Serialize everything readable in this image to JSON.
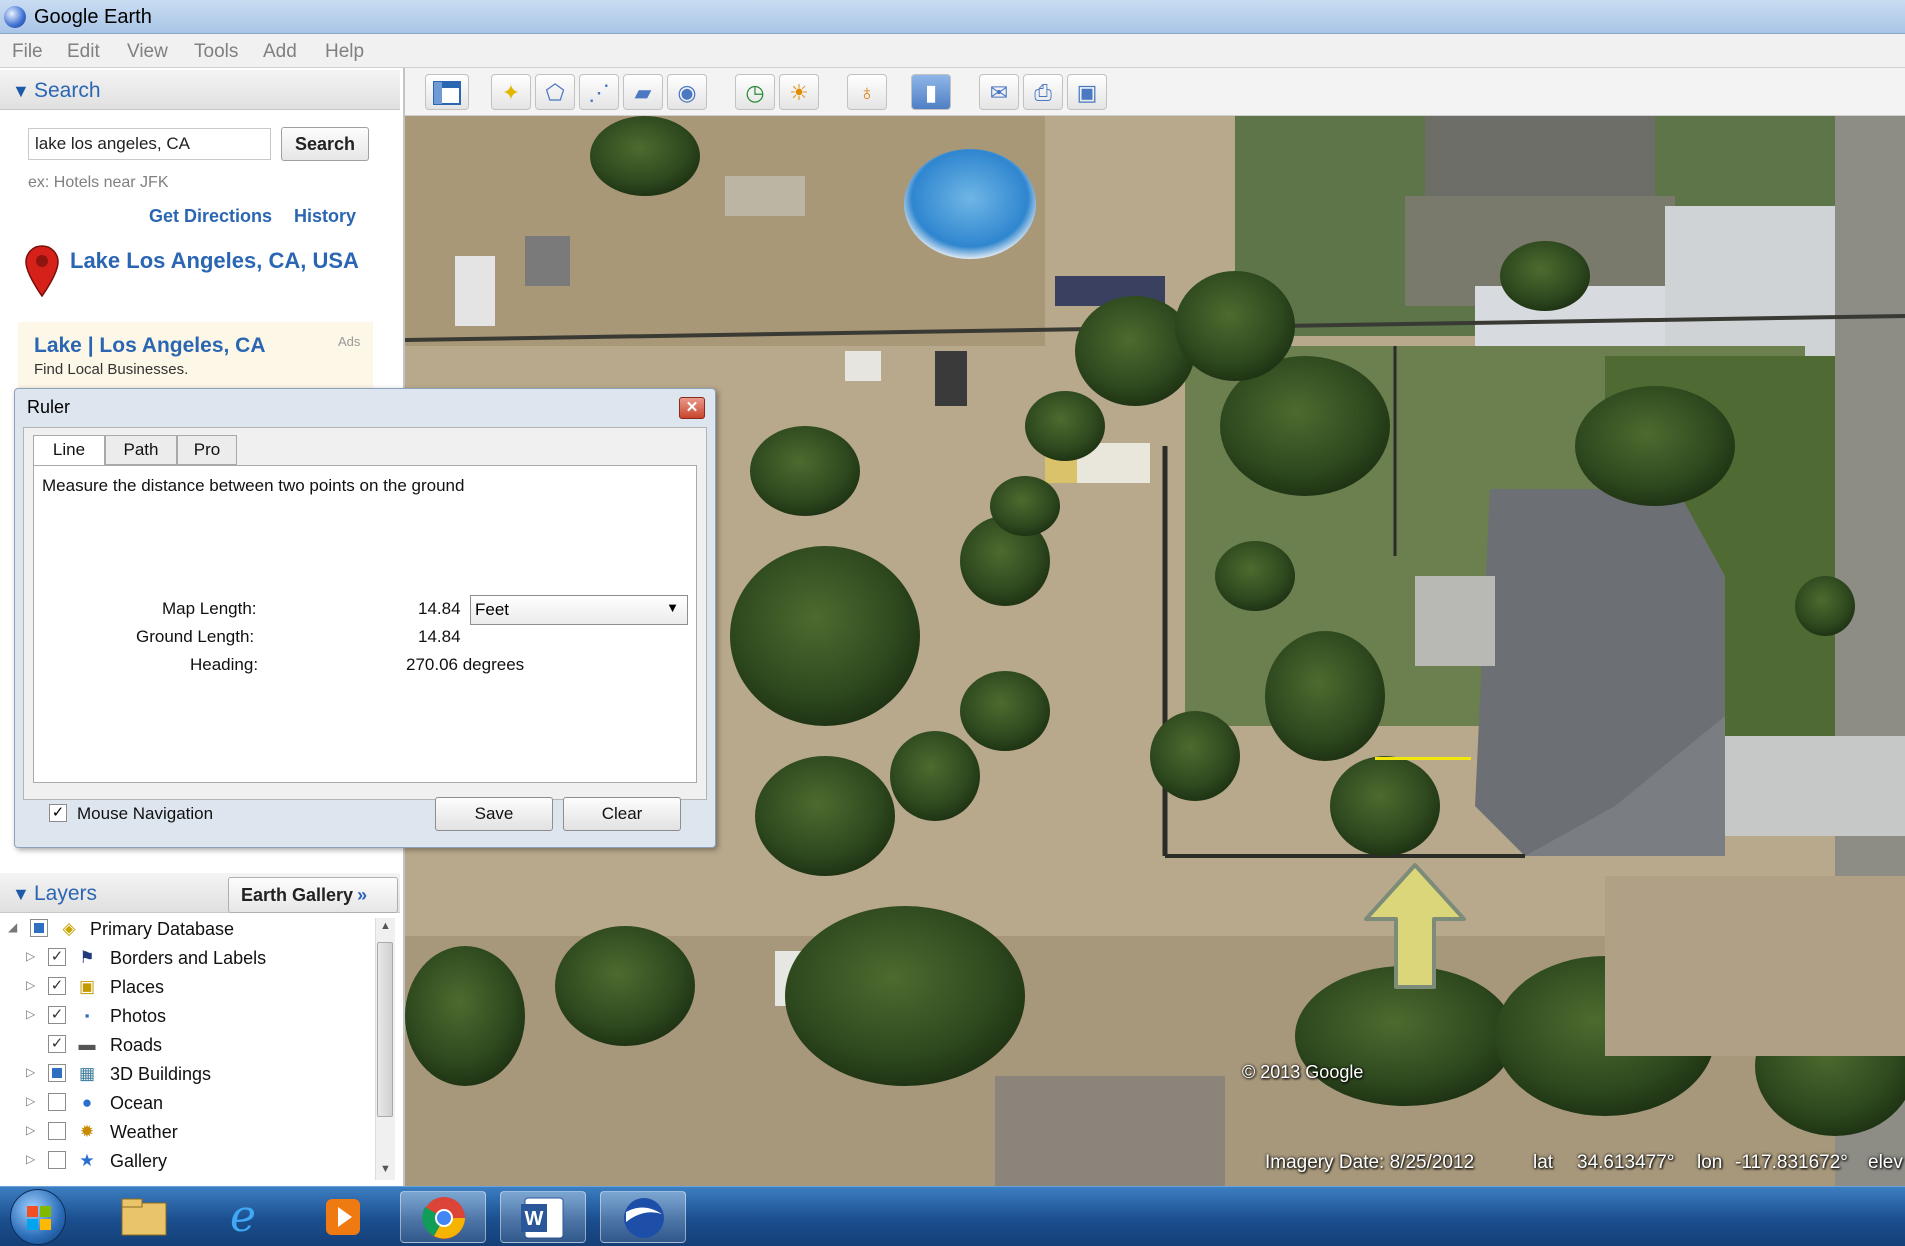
{
  "window": {
    "title": "Google Earth"
  },
  "menu": [
    "File",
    "Edit",
    "View",
    "Tools",
    "Add",
    "Help"
  ],
  "search": {
    "header": "Search",
    "query": "lake los angeles, CA",
    "button": "Search",
    "hint": "ex: Hotels near JFK",
    "get_directions": "Get Directions",
    "history": "History",
    "result_title": "Lake Los Angeles, CA, USA",
    "ad": {
      "title": "Lake | Los Angeles, CA",
      "tag": "Ads",
      "subtitle": "Find Local Businesses."
    }
  },
  "toolbar": {
    "icons": [
      "sidebar-toggle-icon",
      "placemark-icon",
      "polygon-icon",
      "path-icon",
      "overlay-icon",
      "record-tour-icon",
      "historical-imagery-icon",
      "sunlight-icon",
      "planets-icon",
      "ruler-icon",
      "email-icon",
      "print-icon",
      "save-image-icon"
    ]
  },
  "ruler": {
    "title": "Ruler",
    "tabs": [
      "Line",
      "Path",
      "Pro"
    ],
    "active_tab": "Line",
    "description": "Measure the distance between two points on the ground",
    "map_length_label": "Map Length:",
    "map_length_value": "14.84",
    "unit": "Feet",
    "ground_length_label": "Ground Length:",
    "ground_length_value": "14.84",
    "heading_label": "Heading:",
    "heading_value": "270.06 degrees",
    "mouse_navigation_label": "Mouse Navigation",
    "mouse_navigation_checked": true,
    "save": "Save",
    "clear": "Clear"
  },
  "layers": {
    "header": "Layers",
    "gallery_button": "Earth Gallery",
    "gallery_chevron": "»",
    "items": [
      {
        "label": "Primary Database",
        "checked": "partial",
        "icon": "database-icon"
      },
      {
        "label": "Borders and Labels",
        "checked": true,
        "icon": "flag-icon"
      },
      {
        "label": "Places",
        "checked": true,
        "icon": "places-icon"
      },
      {
        "label": "Photos",
        "checked": true,
        "icon": "photos-icon"
      },
      {
        "label": "Roads",
        "checked": true,
        "icon": "roads-icon"
      },
      {
        "label": "3D Buildings",
        "checked": "partial",
        "icon": "buildings-icon"
      },
      {
        "label": "Ocean",
        "checked": false,
        "icon": "ocean-icon"
      },
      {
        "label": "Weather",
        "checked": false,
        "icon": "weather-icon"
      },
      {
        "label": "Gallery",
        "checked": false,
        "icon": "gallery-icon"
      }
    ]
  },
  "map": {
    "copyright": "© 2013 Google",
    "imagery_date": "Imagery Date: 8/25/2012",
    "lat_label": "lat",
    "lat": "34.613477°",
    "lon_label": "lon",
    "lon": "-117.831672°",
    "elev_label": "elev",
    "ruler_line_color": "#f2e60c",
    "arrow_color": "#dcd67a"
  },
  "taskbar": {
    "apps": [
      "windows-start-icon",
      "file-explorer-icon",
      "internet-explorer-icon",
      "media-player-icon",
      "chrome-icon",
      "word-icon",
      "google-earth-icon"
    ]
  },
  "colors": {
    "link": "#2b66b3",
    "taskbar": "#1b4f8f"
  }
}
